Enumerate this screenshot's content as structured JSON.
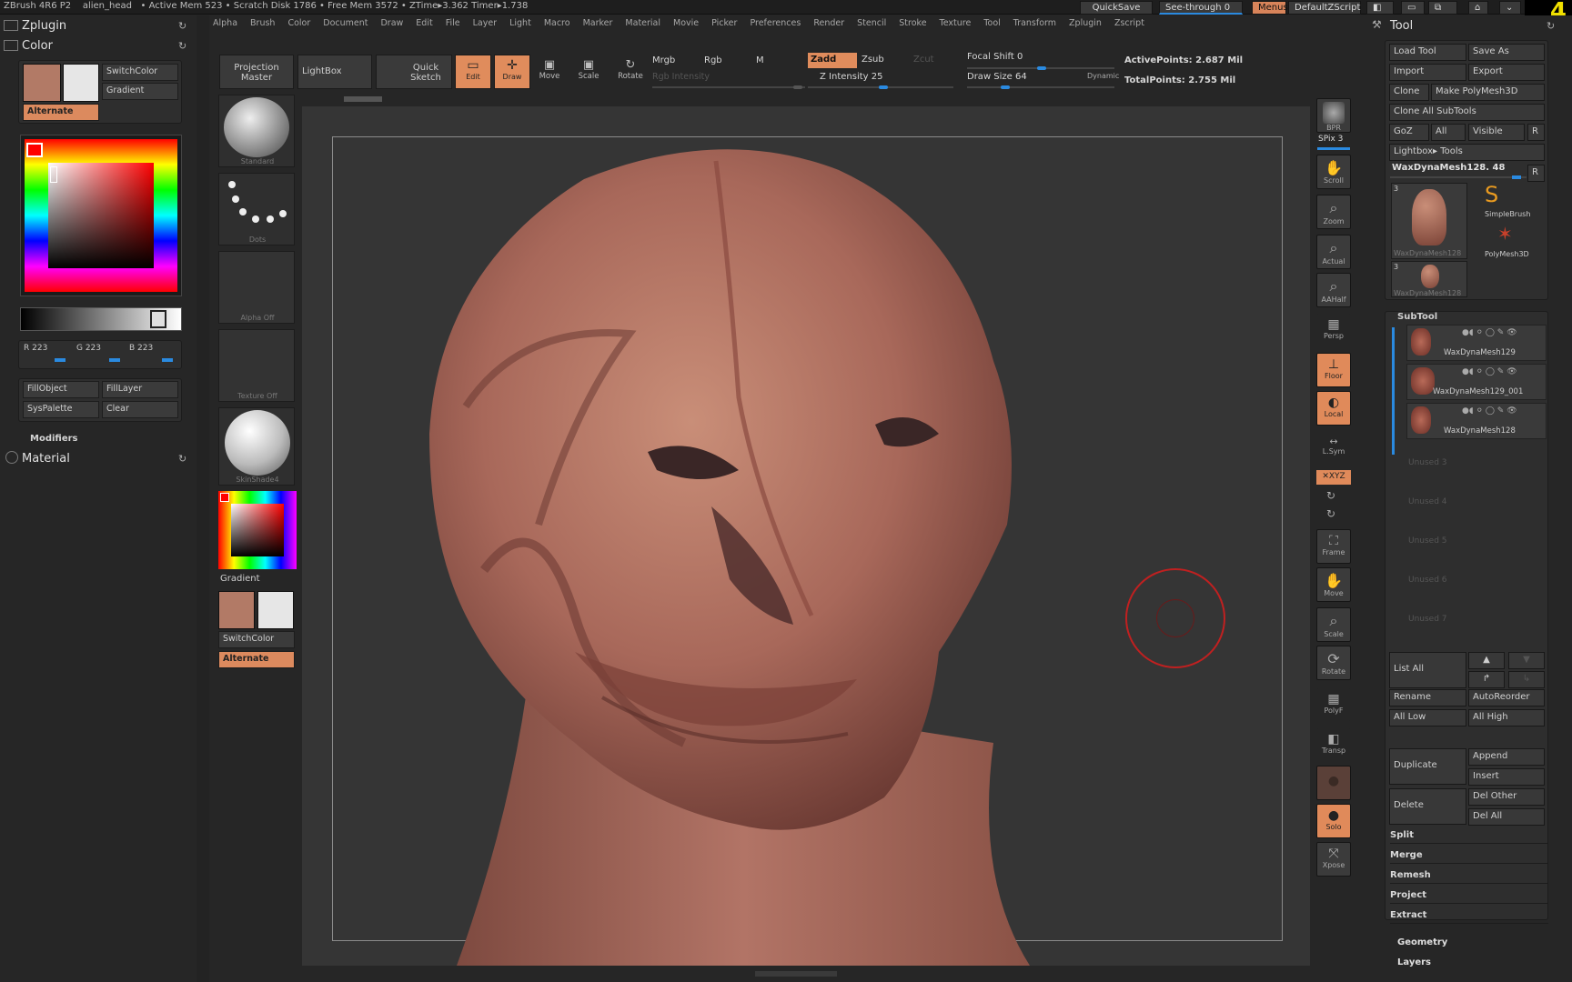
{
  "titlebar": {
    "text": "ZBrush 4R6 P2    alien_head   • Active Mem 523 • Scratch Disk 1786 • Free Mem 3572 • ZTime▸3.362 Timer▸1.738",
    "quicksave": "QuickSave",
    "seethrough": "See-through  0",
    "menus": "Menus",
    "script": "DefaultZScript",
    "corner": "4"
  },
  "menubar": [
    "Alpha",
    "Brush",
    "Color",
    "Document",
    "Draw",
    "Edit",
    "File",
    "Layer",
    "Light",
    "Macro",
    "Marker",
    "Material",
    "Movie",
    "Picker",
    "Preferences",
    "Render",
    "Stencil",
    "Stroke",
    "Texture",
    "Tool",
    "Transform",
    "Zplugin",
    "Zscript"
  ],
  "left": {
    "zplugin": "Zplugin",
    "color": "Color",
    "switchcolor": "SwitchColor",
    "gradient": "Gradient",
    "alternate": "Alternate",
    "r": "R 223",
    "g": "G 223",
    "b": "B 223",
    "fillobject": "FillObject",
    "filllayer": "FillLayer",
    "syspalette": "SysPalette",
    "clear": "Clear",
    "modifiers": "Modifiers",
    "material": "Material"
  },
  "shelf": {
    "standard": "Standard",
    "dots": "Dots",
    "alpha": "Alpha  Off",
    "texture": "Texture  Off",
    "skinshade": "SkinShade4",
    "gradient": "Gradient",
    "switchcolor": "SwitchColor",
    "alternate": "Alternate"
  },
  "toolbar": {
    "projection": "Projection Master",
    "lightbox": "LightBox",
    "quicksketch": "Quick Sketch",
    "edit": "Edit",
    "draw": "Draw",
    "move": "Move",
    "scale": "Scale",
    "rotate": "Rotate",
    "mrgb": "Mrgb",
    "rgb": "Rgb",
    "m": "M",
    "rgb_intensity": "Rgb  Intensity",
    "zadd": "Zadd",
    "zsub": "Zsub",
    "zcut": "Zcut",
    "z_intensity": "Z  Intensity 25",
    "focal": "Focal  Shift 0",
    "drawsize": "Draw  Size 64",
    "dynamic": "Dynamic",
    "active": "ActivePoints: 2.687  Mil",
    "total": "TotalPoints: 2.755  Mil"
  },
  "righttools": {
    "bpr": "BPR",
    "spix": "SPix 3",
    "scroll": "Scroll",
    "zoom": "Zoom",
    "actual": "Actual",
    "aahalf": "AAHalf",
    "persp": "Persp",
    "floor": "Floor",
    "local": "Local",
    "lsym": "L.Sym",
    "xyz": "✕XYZ",
    "frame": "Frame",
    "move": "Move",
    "scale": "Scale",
    "rotate": "Rotate",
    "polyf": "PolyF",
    "transp": "Transp",
    "solo": "Solo",
    "xpose": "Xpose"
  },
  "tool": {
    "title": "Tool",
    "load": "Load  Tool",
    "saveas": "Save  As",
    "import": "Import",
    "export": "Export",
    "clone": "Clone",
    "makepoly": "Make  PolyMesh3D",
    "cloneall": "Clone  All  SubTools",
    "goz": "GoZ",
    "all": "All",
    "visible": "Visible",
    "r": "R",
    "lightbox_tools": "Lightbox▸ Tools",
    "current": "WaxDynaMesh128. 48",
    "thumb1": "WaxDynaMesh128",
    "thumb2": "WaxDynaMesh128",
    "simplebrush": "SimpleBrush",
    "polymesh": "PolyMesh3D",
    "n1": "3",
    "n2": "3"
  },
  "subtool": {
    "title": "SubTool",
    "items": [
      "WaxDynaMesh129",
      "WaxDynaMesh129_001",
      "WaxDynaMesh128"
    ],
    "unused": [
      "Unused  3",
      "Unused  4",
      "Unused  5",
      "Unused  6",
      "Unused  7"
    ],
    "listall": "List  All",
    "rename": "Rename",
    "autoreorder": "AutoReorder",
    "alllow": "All  Low",
    "allhigh": "All  High",
    "duplicate": "Duplicate",
    "append": "Append",
    "insert": "Insert",
    "delete": "Delete",
    "delother": "Del  Other",
    "delall": "Del  All",
    "split": "Split",
    "merge": "Merge",
    "remesh": "Remesh",
    "project": "Project",
    "extract": "Extract",
    "geometry": "Geometry",
    "layers": "Layers"
  },
  "colors": {
    "accent": "#e08c5c",
    "blue": "#2a8ae0",
    "skin": "#b87c66"
  }
}
